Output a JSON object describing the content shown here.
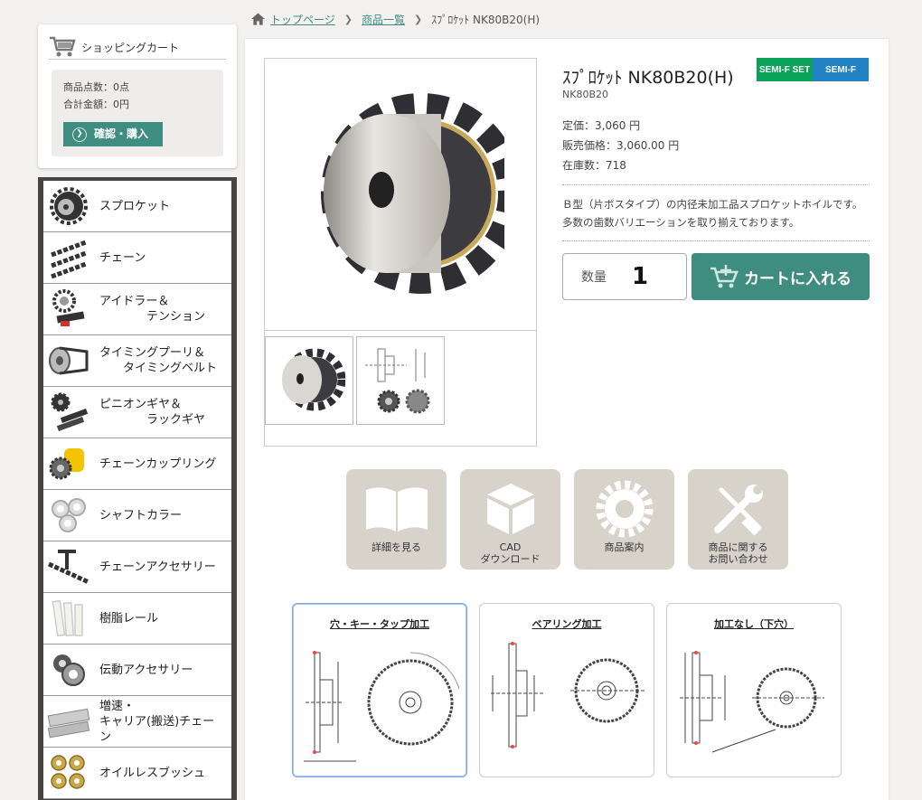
{
  "breadcrumb": {
    "home": "トップページ",
    "list": "商品一覧",
    "current": "ｽﾌﾟﾛｹｯﾄ NK80B20(H)"
  },
  "cart": {
    "title": "ショッピングカート",
    "items_count": "商品点数：0点",
    "total": "合計金額：0円",
    "button": "確認・購入"
  },
  "categories": [
    {
      "label": "スプロケット",
      "icon": "sprocket-icon"
    },
    {
      "label": "チェーン",
      "icon": "chain-icon"
    },
    {
      "label": "アイドラー＆\n　　　　テンション",
      "icon": "idler-icon"
    },
    {
      "label": "タイミングプーリ＆\n　　タイミングベルト",
      "icon": "timing-pulley-icon"
    },
    {
      "label": "ピニオンギヤ＆\n　　　　ラックギヤ",
      "icon": "pinion-gear-icon"
    },
    {
      "label": "チェーンカップリング",
      "icon": "coupling-icon"
    },
    {
      "label": "シャフトカラー",
      "icon": "shaft-collar-icon"
    },
    {
      "label": "チェーンアクセサリー",
      "icon": "chain-accessory-icon"
    },
    {
      "label": "樹脂レール",
      "icon": "resin-rail-icon"
    },
    {
      "label": "伝動アクセサリー",
      "icon": "transmission-accessory-icon"
    },
    {
      "label": "増速・\nキャリア(搬送)チェーン",
      "icon": "carrier-chain-icon"
    },
    {
      "label": "オイルレスブッシュ",
      "icon": "bushing-icon"
    }
  ],
  "product": {
    "name": "ｽﾌﾟﾛｹｯﾄ NK80B20(H)",
    "code": "NK80B20",
    "list_price": "定価：3,060 円",
    "sale_price": "販売価格：3,060.00 円",
    "stock": "在庫数：718",
    "description": "Ｂ型（片ボスタイプ）の内径未加工品スプロケットホイルです。多数の歯数バリエーションを取り揃えております。",
    "badge_set": "SEMI-F SET",
    "badge_semi": "SEMI-F"
  },
  "purchase": {
    "qty_label": "数量",
    "qty_value": "1",
    "add_to_cart": "カートに入れる"
  },
  "actions": [
    {
      "label": "詳細を見る",
      "icon": "book-icon"
    },
    {
      "label": "CAD\nダウンロード",
      "icon": "cube-icon"
    },
    {
      "label": "商品案内",
      "icon": "gear-icon"
    },
    {
      "label": "商品に関する\nお問い合わせ",
      "icon": "tools-icon"
    }
  ],
  "processing": [
    {
      "label": "穴・キー・タップ加工"
    },
    {
      "label": "ベアリング加工"
    },
    {
      "label": "加工なし（下穴）"
    }
  ],
  "colors": {
    "accent": "#3f8d80",
    "badge_green": "#0aa158",
    "badge_blue": "#2081c3",
    "nav_border": "#444444"
  }
}
